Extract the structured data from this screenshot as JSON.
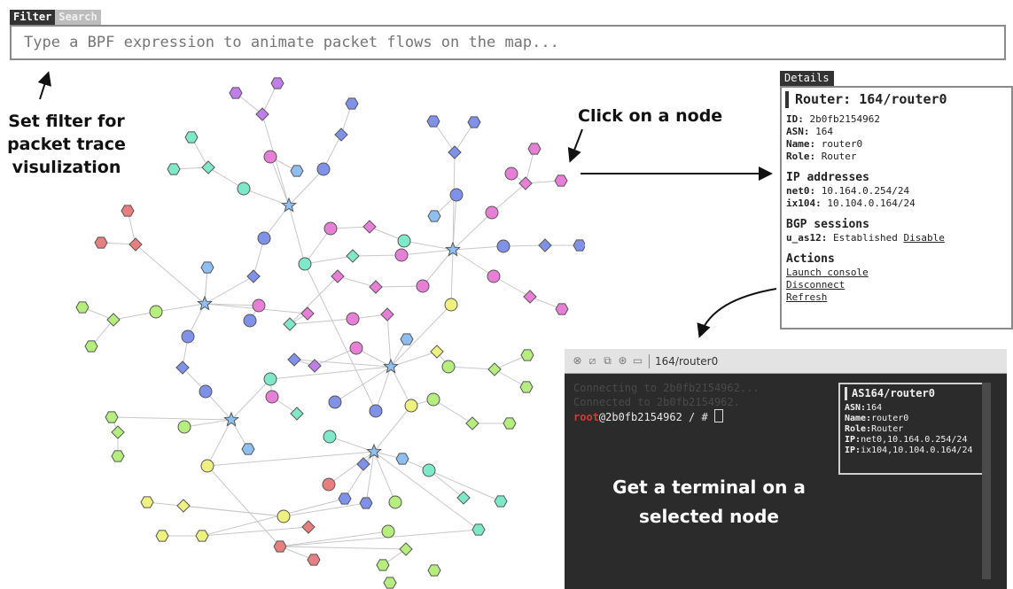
{
  "filter_bar": {
    "tabs": [
      {
        "label": "Filter",
        "active": true
      },
      {
        "label": "Search",
        "active": false
      }
    ],
    "placeholder": "Type a BPF expression to animate packet flows on the map..."
  },
  "annotations": {
    "filter": [
      "Set filter for",
      "packet trace",
      "visulization"
    ],
    "click": "Click on a node",
    "terminal": [
      "Get a terminal on a",
      "selected node"
    ]
  },
  "details": {
    "tab_label": "Details",
    "title": "Router: 164/router0",
    "fields": [
      {
        "key": "ID:",
        "value": "2b0fb2154962"
      },
      {
        "key": "ASN:",
        "value": "164"
      },
      {
        "key": "Name:",
        "value": "router0"
      },
      {
        "key": "Role:",
        "value": "Router"
      }
    ],
    "ip_heading": "IP addresses",
    "ips": [
      {
        "key": "net0:",
        "value": "10.164.0.254/24"
      },
      {
        "key": "ix104:",
        "value": "10.104.0.164/24"
      }
    ],
    "bgp_heading": "BGP sessions",
    "bgp": {
      "key": "u_as12:",
      "status": "Established",
      "action": "Disable"
    },
    "actions_heading": "Actions",
    "actions": [
      "Launch console",
      "Disconnect",
      "Refresh"
    ]
  },
  "terminal": {
    "tab_title": "164/router0",
    "lines": [
      "Connecting to 2b0fb2154962...",
      "Connected to 2b0fb2154962."
    ],
    "prompt_user": "root",
    "prompt_rest": "@2b0fb2154962 / #",
    "infobox": {
      "title": "AS164/router0",
      "lines": [
        {
          "key": "ASN:",
          "value": "164"
        },
        {
          "key": "Name:",
          "value": "router0"
        },
        {
          "key": "Role:",
          "value": "Router"
        },
        {
          "key": "IP:",
          "value": "net0,10.164.0.254/24"
        },
        {
          "key": "IP:",
          "value": "ix104,10.104.0.164/24"
        }
      ]
    }
  },
  "colors": {
    "teal": "#7fe8c8",
    "blue": "#7f92e8",
    "pink": "#e87fd6",
    "red": "#e87f7f",
    "yellow": "#eef07f",
    "green": "#b5ee7f",
    "lightblue": "#8fbff0",
    "purple": "#c07fe8"
  }
}
